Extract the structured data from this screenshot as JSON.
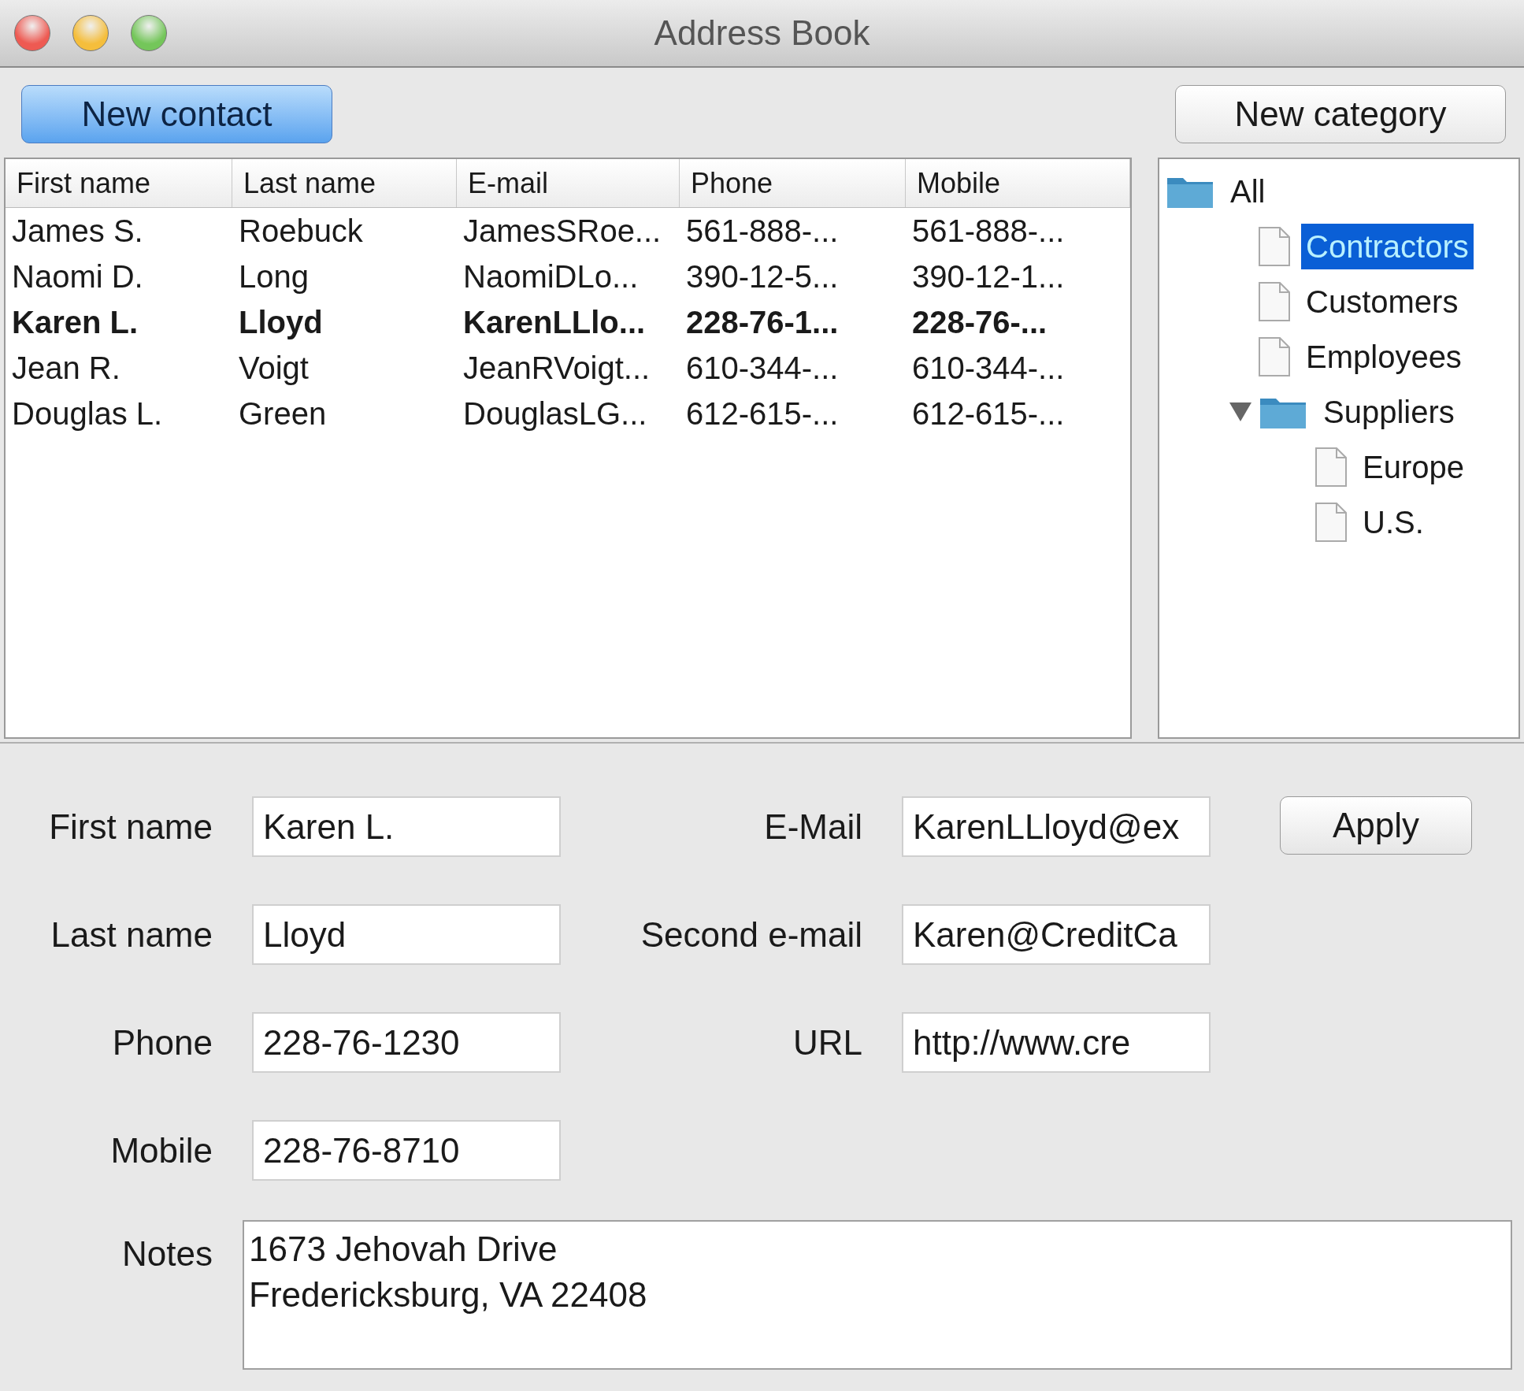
{
  "window": {
    "title": "Address Book"
  },
  "toolbar": {
    "new_contact": "New contact",
    "new_category": "New category"
  },
  "table": {
    "columns": [
      "First name",
      "Last name",
      "E-mail",
      "Phone",
      "Mobile"
    ],
    "rows": [
      {
        "cells": [
          "James S.",
          "Roebuck",
          "JamesSRoe...",
          "561-888-...",
          "561-888-..."
        ],
        "selected": false
      },
      {
        "cells": [
          "Naomi D.",
          "Long",
          "NaomiDLo...",
          "390-12-5...",
          "390-12-1..."
        ],
        "selected": false
      },
      {
        "cells": [
          "Karen L.",
          "Lloyd",
          "KarenLLlo...",
          "228-76-1...",
          "228-76-..."
        ],
        "selected": true
      },
      {
        "cells": [
          "Jean R.",
          "Voigt",
          "JeanRVoigt...",
          "610-344-...",
          "610-344-..."
        ],
        "selected": false
      },
      {
        "cells": [
          "Douglas L.",
          "Green",
          "DouglasLG...",
          "612-615-...",
          "612-615-..."
        ],
        "selected": false
      }
    ]
  },
  "categories": [
    {
      "label": "All",
      "kind": "folder",
      "selected": false,
      "children": [
        {
          "label": "Contractors",
          "kind": "file",
          "selected": true
        },
        {
          "label": "Customers",
          "kind": "file",
          "selected": false
        },
        {
          "label": "Employees",
          "kind": "file",
          "selected": false
        },
        {
          "label": "Suppliers",
          "kind": "folder",
          "selected": false,
          "expanded": true,
          "children": [
            {
              "label": "Europe",
              "kind": "file",
              "selected": false
            },
            {
              "label": "U.S.",
              "kind": "file",
              "selected": false
            }
          ]
        }
      ]
    }
  ],
  "form": {
    "left": [
      {
        "label": "First name",
        "value": "Karen L."
      },
      {
        "label": "Last name",
        "value": "Lloyd"
      },
      {
        "label": "Phone",
        "value": "228-76-1230"
      },
      {
        "label": "Mobile",
        "value": "228-76-8710"
      }
    ],
    "right": [
      {
        "label": "E-Mail",
        "value": "KarenLLloyd@ex"
      },
      {
        "label": "Second e-mail",
        "value": "Karen@CreditCa"
      },
      {
        "label": "URL",
        "value": "http://www.cre"
      }
    ],
    "apply": "Apply",
    "notes": {
      "label": "Notes",
      "lines": [
        "1673 Jehovah Drive",
        "Fredericksburg, VA 22408"
      ]
    }
  }
}
